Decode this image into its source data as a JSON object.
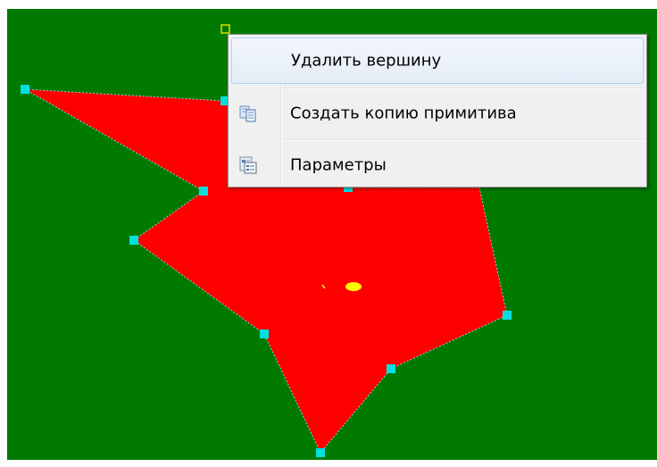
{
  "canvas": {
    "background_color": "#007a00",
    "polygon_fill_color": "#ff0000",
    "vertex_handle_color": "#00e0e0",
    "edge_color": "#7fd7d7",
    "selected_vertex_color": "#e0e000",
    "center_marker_color": "#ffff00"
  },
  "context_menu": {
    "items": [
      {
        "label": "Удалить вершину",
        "icon": "none",
        "highlighted": true
      },
      {
        "label": "Создать копию примитива",
        "icon": "copy-icon",
        "highlighted": false
      },
      {
        "label": "Параметры",
        "icon": "properties-icon",
        "highlighted": false
      }
    ]
  }
}
